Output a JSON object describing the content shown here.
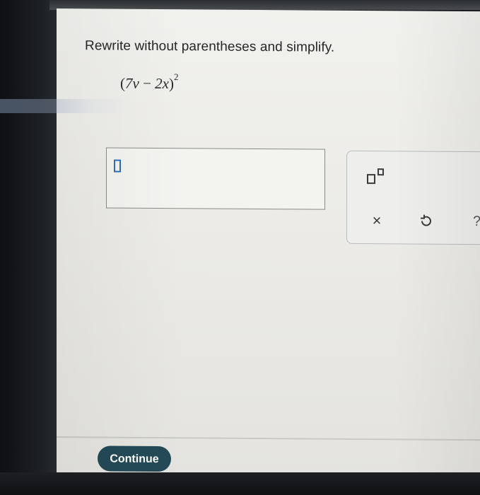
{
  "question": {
    "prompt": "Rewrite without parentheses and simplify.",
    "expression": {
      "open_paren": "(",
      "term1": "7v",
      "operator": " − ",
      "term2": "2x",
      "close_paren": ")",
      "exponent": "2"
    }
  },
  "answer": {
    "value": ""
  },
  "keypad": {
    "exponent_button": "exponent-icon",
    "clear_label": "×",
    "undo_icon": "undo-icon",
    "help_label": "?"
  },
  "footer": {
    "continue_label": "Continue"
  },
  "colors": {
    "continue_bg": "#244a57",
    "cursor": "#2f6fb5"
  }
}
